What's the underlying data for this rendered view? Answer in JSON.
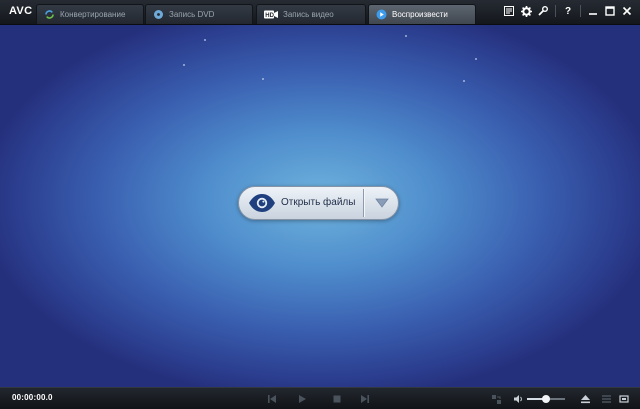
{
  "app": {
    "logo": "AVC"
  },
  "tabs": [
    {
      "label": "Конвертирование",
      "icon": "convert-icon",
      "active": false
    },
    {
      "label": "Запись DVD",
      "icon": "disc-icon",
      "active": false
    },
    {
      "label": "Запись видео",
      "icon": "hd-video-icon",
      "active": false
    },
    {
      "label": "Воспроизвести",
      "icon": "play-circle-icon",
      "active": true
    }
  ],
  "window_controls": [
    "notes-icon",
    "gear-icon",
    "wrench-icon",
    "help-icon",
    "minimize-icon",
    "maximize-icon",
    "close-icon"
  ],
  "window_labels": {
    "help": "?"
  },
  "main": {
    "open_button": {
      "label": "Открыть файлы",
      "icon": "eye-icon"
    }
  },
  "player": {
    "timecode": "00:00:00.0",
    "volume": 0.5
  },
  "colors": {
    "accent_blue": "#4e8ccc",
    "titlebar": "#1c2026",
    "active_tab": "#4d555f"
  }
}
